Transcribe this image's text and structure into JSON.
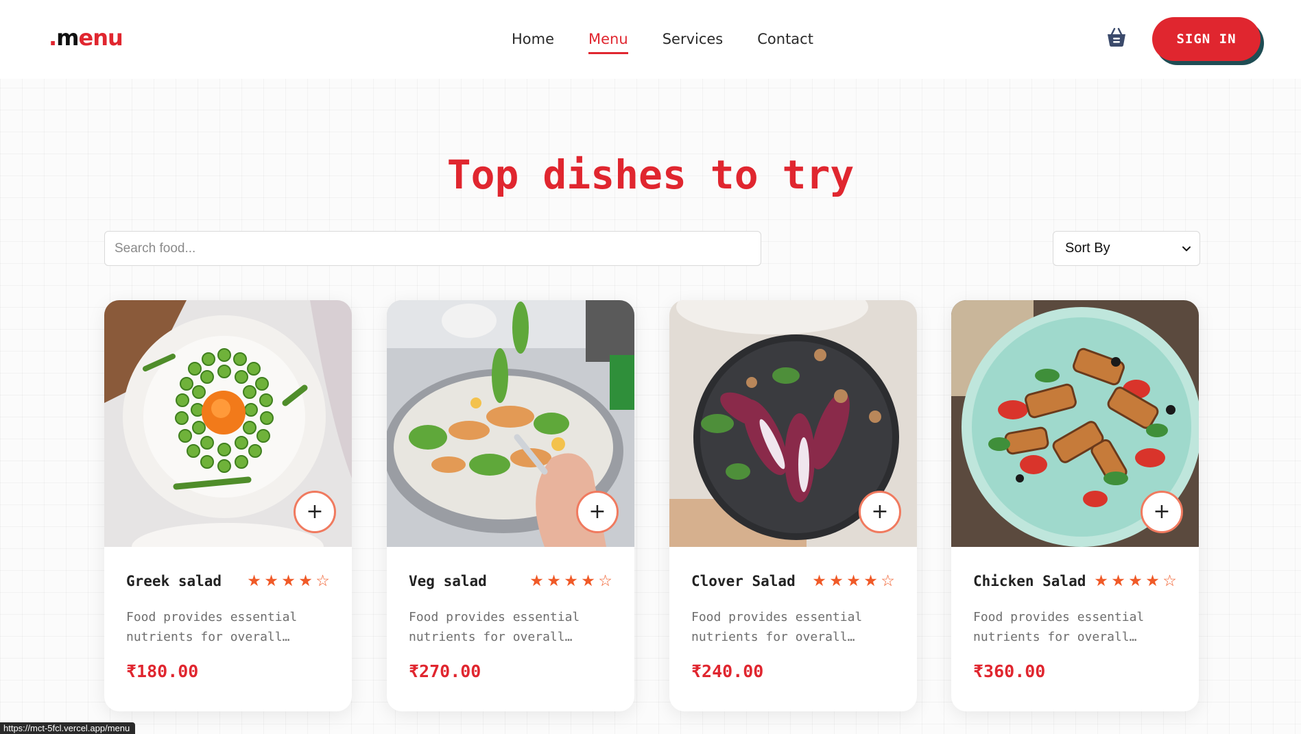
{
  "header": {
    "logo": {
      "dot": ".",
      "m": "m",
      "rest": "enu"
    },
    "nav": [
      {
        "label": "Home",
        "active": false
      },
      {
        "label": "Menu",
        "active": true
      },
      {
        "label": "Services",
        "active": false
      },
      {
        "label": "Contact",
        "active": false
      }
    ],
    "cart_icon": "basket-icon",
    "sign_in_label": "SIGN IN"
  },
  "main": {
    "title": "Top dishes to try",
    "search": {
      "placeholder": "Search food...",
      "value": ""
    },
    "sort": {
      "selected": "Sort By"
    },
    "cards": [
      {
        "name": "Greek salad",
        "rating": 4,
        "max_rating": 5,
        "desc": "Food provides essential\nnutrients for overall…",
        "price": "₹180.00",
        "image": "greek-salad-photo"
      },
      {
        "name": "Veg salad",
        "rating": 4,
        "max_rating": 5,
        "desc": "Food provides essential\nnutrients for overall…",
        "price": "₹270.00",
        "image": "veg-salad-photo"
      },
      {
        "name": "Clover Salad",
        "rating": 4,
        "max_rating": 5,
        "desc": "Food provides essential\nnutrients for overall…",
        "price": "₹240.00",
        "image": "clover-salad-photo"
      },
      {
        "name": "Chicken Salad",
        "rating": 4,
        "max_rating": 5,
        "desc": "Food provides essential\nnutrients for overall…",
        "price": "₹360.00",
        "image": "chicken-salad-photo"
      }
    ]
  },
  "status_bar": {
    "url": "https://mct-5fcl.vercel.app/menu"
  },
  "colors": {
    "accent": "#e0262f",
    "star": "#f05a28",
    "button_shadow": "#1f4d54",
    "text": "#2a2a2a"
  }
}
